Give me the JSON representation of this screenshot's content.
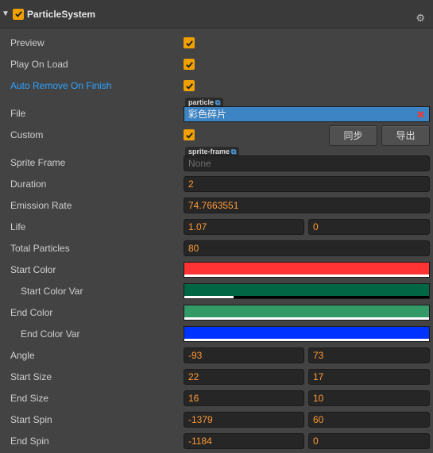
{
  "component": {
    "title": "ParticleSystem",
    "fold_icon": "triangle-down",
    "enabled": true
  },
  "colors": {
    "accent": "#f0a000",
    "value": "#ff9a36",
    "link": "#2ea1ff",
    "asset": "#3c84c4"
  },
  "props": {
    "preview": {
      "label": "Preview",
      "checked": true
    },
    "play_on_load": {
      "label": "Play On Load",
      "checked": true
    },
    "auto_remove": {
      "label": "Auto Remove On Finish",
      "checked": true
    },
    "file": {
      "label": "File",
      "asset_type": "particle",
      "value": "彩色碎片"
    },
    "custom": {
      "label": "Custom",
      "checked": true,
      "sync_label": "同步",
      "export_label": "导出"
    },
    "sprite_frame": {
      "label": "Sprite Frame",
      "asset_type": "sprite-frame",
      "value": "None"
    },
    "duration": {
      "label": "Duration",
      "value": "2"
    },
    "emission_rate": {
      "label": "Emission Rate",
      "value": "74.7663551"
    },
    "life": {
      "label": "Life",
      "value": "1.07",
      "var": "0"
    },
    "total_particles": {
      "label": "Total Particles",
      "value": "80"
    },
    "start_color": {
      "label": "Start Color",
      "color": "#ff3333",
      "alpha": 1.0
    },
    "start_color_var": {
      "label": "Start Color Var",
      "color": "#006644",
      "alpha": 0.2
    },
    "end_color": {
      "label": "End Color",
      "color": "#339966",
      "alpha": 1.0
    },
    "end_color_var": {
      "label": "End Color Var",
      "color": "#0033ff",
      "alpha": 1.0
    },
    "angle": {
      "label": "Angle",
      "value": "-93",
      "var": "73"
    },
    "start_size": {
      "label": "Start Size",
      "value": "22",
      "var": "17"
    },
    "end_size": {
      "label": "End Size",
      "value": "16",
      "var": "10"
    },
    "start_spin": {
      "label": "Start Spin",
      "value": "-1379",
      "var": "60"
    },
    "end_spin": {
      "label": "End Spin",
      "value": "-1184",
      "var": "0"
    }
  }
}
